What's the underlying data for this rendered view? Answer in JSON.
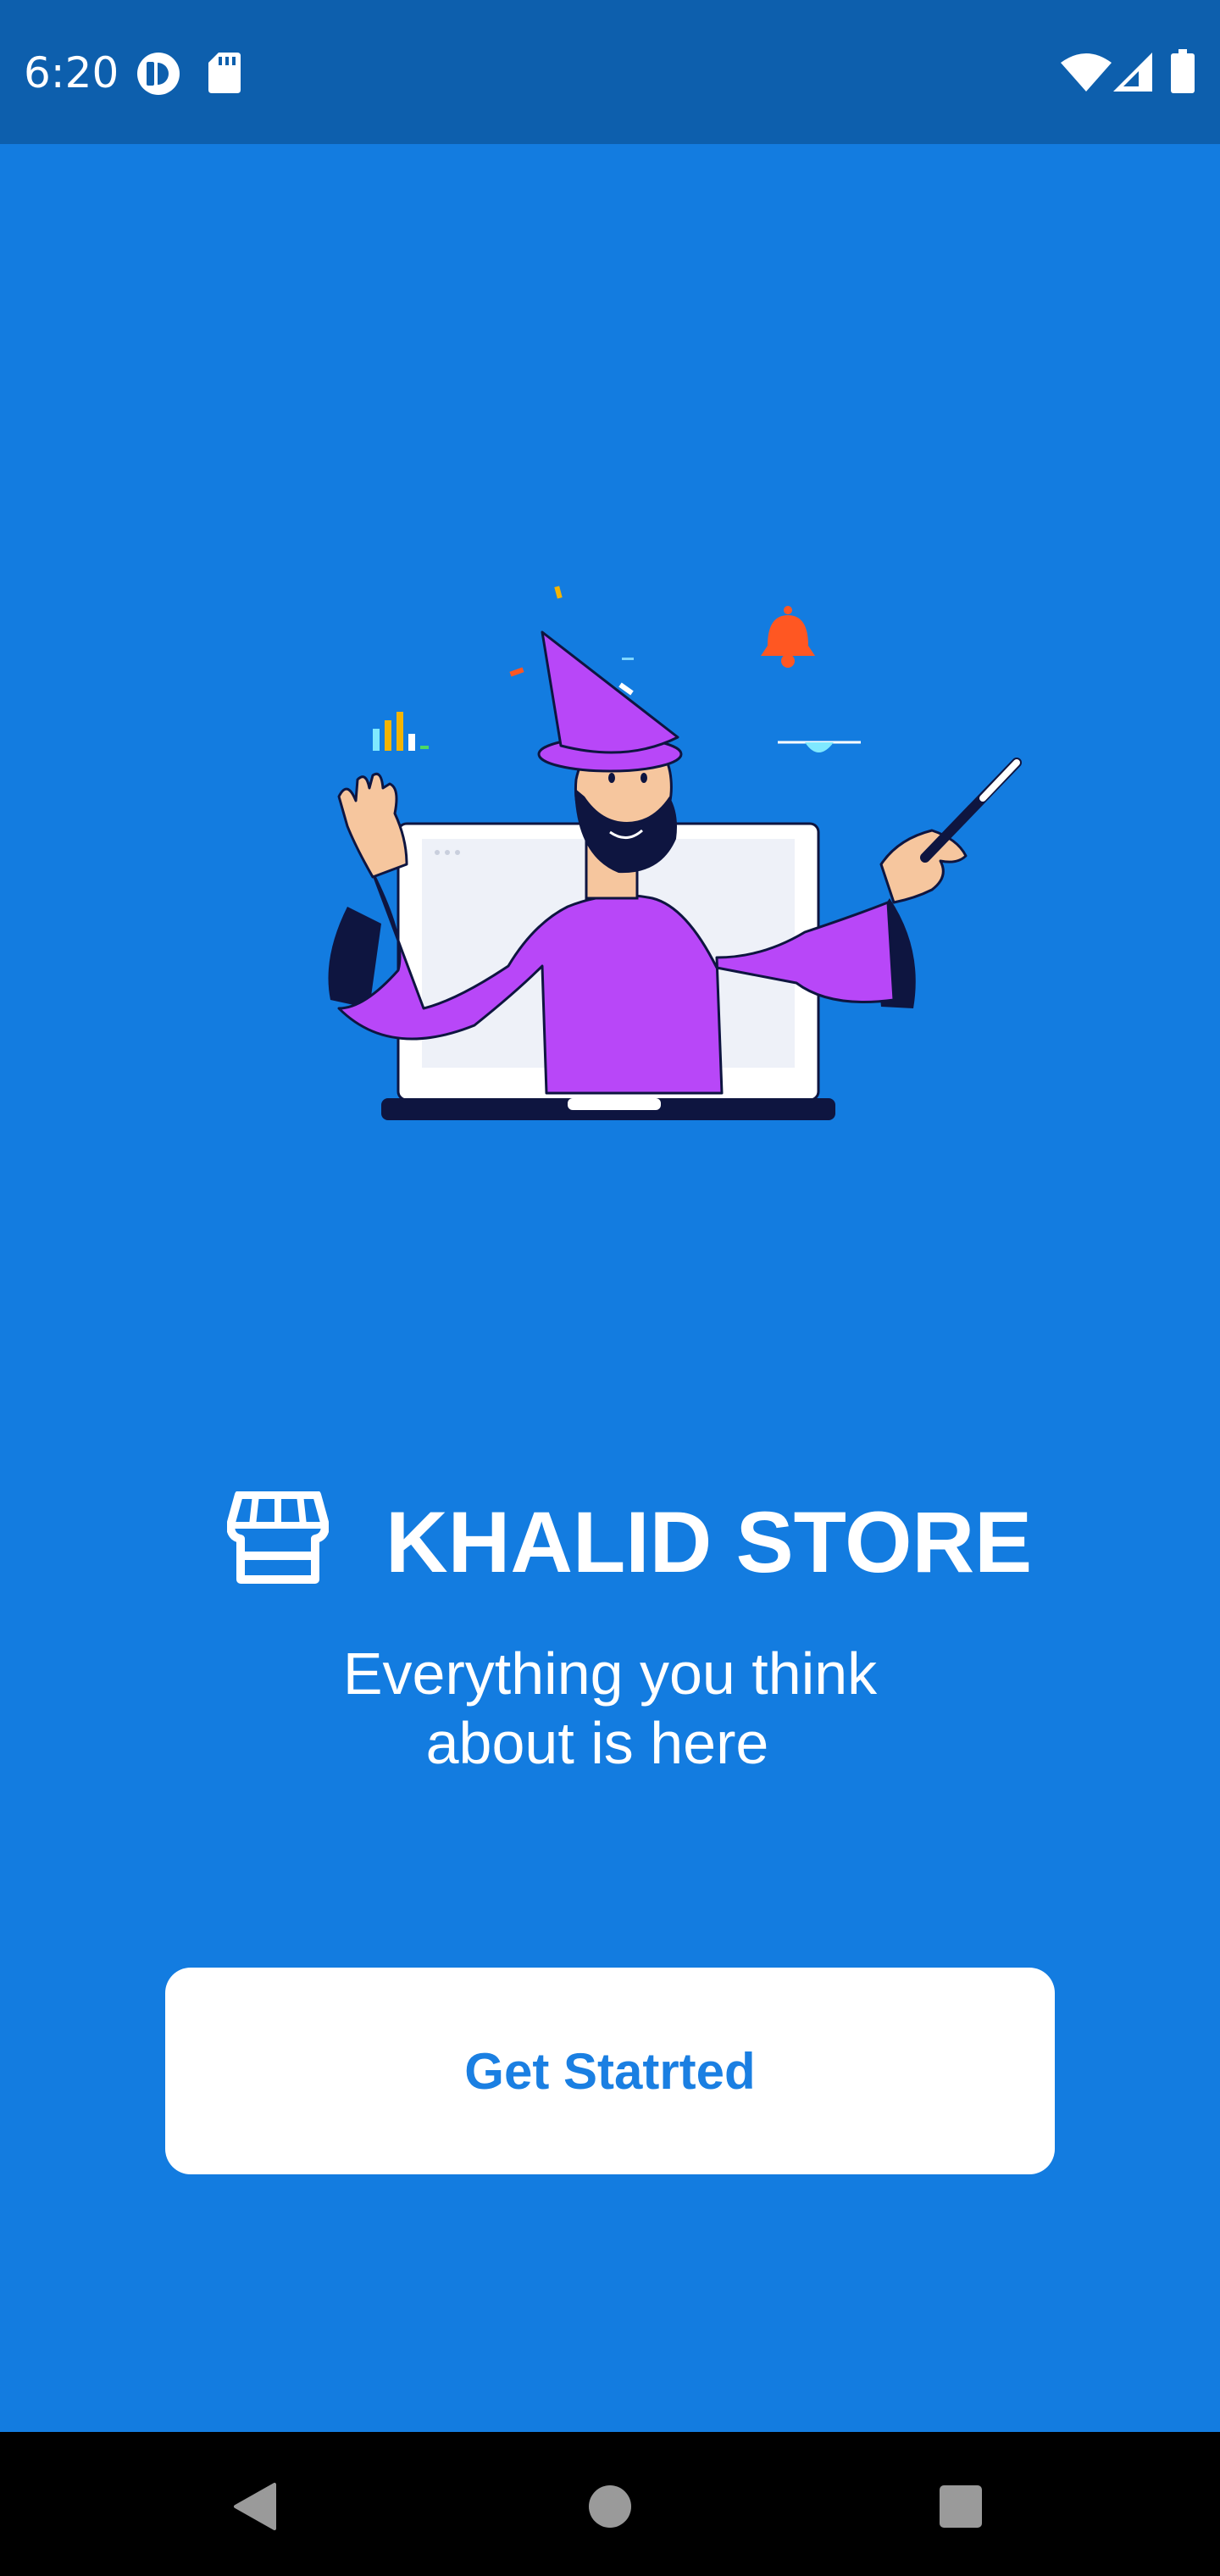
{
  "status_bar": {
    "time": "6:20",
    "icons": [
      "notification-circle-icon",
      "sd-card-icon",
      "wifi-icon",
      "signal-icon",
      "battery-icon"
    ]
  },
  "illustration": {
    "description_icon": "wizard-illustration",
    "colors": {
      "robe": "#B847F8",
      "skin": "#F6C69E",
      "beard": "#0E1540",
      "laptop": "#FFFFFF",
      "bell": "#FF5722"
    }
  },
  "brand": {
    "name": "KHALID STORE",
    "icon": "store-icon"
  },
  "tagline": {
    "line1": "Everything you think",
    "line2": "about is here"
  },
  "cta": {
    "label": "Get Statrted"
  },
  "nav_bar": {
    "buttons": [
      "back-icon",
      "home-icon",
      "recents-icon"
    ]
  },
  "colors": {
    "background": "#137CE0",
    "status_bar": "#0D5FAD",
    "button_text": "#1A7FE2",
    "nav_bar": "#000000"
  }
}
